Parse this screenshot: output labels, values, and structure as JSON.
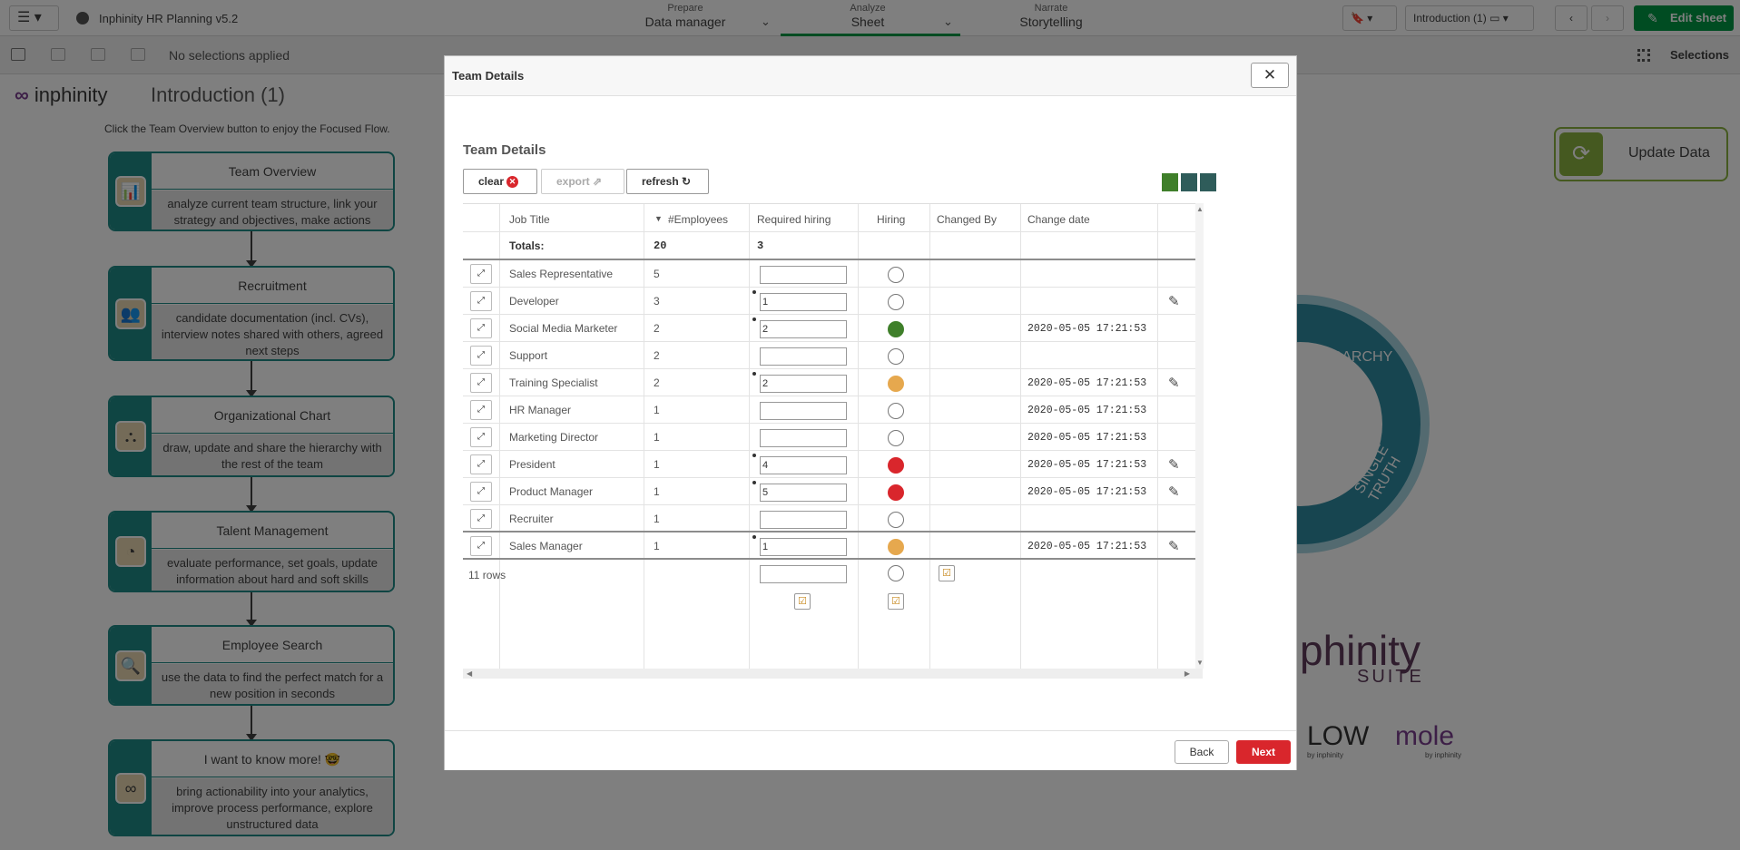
{
  "topbar": {
    "app_title": "Inphinity HR Planning v5.2",
    "prepare_label": "Prepare",
    "prepare_value": "Data manager",
    "analyze_label": "Analyze",
    "analyze_value": "Sheet",
    "narrate_label": "Narrate",
    "narrate_value": "Storytelling",
    "sheet_name": "Introduction (1)",
    "edit_label": "Edit sheet"
  },
  "selectionbar": {
    "no_selections": "No selections applied",
    "selections_label": "Selections"
  },
  "sheet": {
    "logo_text": "inphinity",
    "title": "Introduction (1)",
    "hint": "Click the Team Overview button to enjoy the Focused Flow.",
    "update_label": "Update Data",
    "cards": [
      {
        "title": "Team Overview",
        "desc": "analyze current team structure, link your strategy and objectives, make actions"
      },
      {
        "title": "Recruitment",
        "desc": "candidate documentation (incl. CVs), interview notes shared with others, agreed next steps"
      },
      {
        "title": "Organizational Chart",
        "desc": "draw, update and share the hierarchy with the rest of the team"
      },
      {
        "title": "Talent Management",
        "desc": "evaluate performance, set goals, update information about hard and soft skills"
      },
      {
        "title": "Employee Search",
        "desc": "use the data to find the perfect match for a new position in seconds"
      },
      {
        "title": "I want to know more! 🤓",
        "desc": "bring actionability into your analytics, improve process performance, explore unstructured data"
      }
    ],
    "ring_hierarchy": "HIERARCHY",
    "ring_truth": "SINGLE TRUTH",
    "suite_brand": "phinity",
    "suite_word": "SUITE",
    "flow_brand": "LOW",
    "mole_brand": "mole",
    "by_inphinity_1": "by inphinity",
    "by_inphinity_2": "by inphinity"
  },
  "modal": {
    "title": "Team Details",
    "section_title": "Team Details",
    "clear_label": "clear",
    "export_label": "export",
    "refresh_label": "refresh",
    "back_label": "Back",
    "next_label": "Next",
    "columns": [
      "Job Title",
      "#Employees",
      "Required hiring",
      "Hiring",
      "Changed By",
      "Change date"
    ],
    "totals_label": "Totals:",
    "total_employees": "20",
    "total_required": "3",
    "rows_count": "11 rows",
    "status_colors": {
      "green": "#3f7f2a",
      "orange": "#e6a84e",
      "red": "#d9262c",
      "empty": "#ffffff"
    },
    "rows": [
      {
        "job": "Sales Representative",
        "emp": "5",
        "req": "",
        "status": "empty",
        "date": "",
        "edit": false
      },
      {
        "job": "Developer",
        "emp": "3",
        "req": "1",
        "status": "empty",
        "date": "",
        "edit": true
      },
      {
        "job": "Social Media Marketer",
        "emp": "2",
        "req": "2",
        "status": "green",
        "date": "2020-05-05 17:21:53",
        "edit": false
      },
      {
        "job": "Support",
        "emp": "2",
        "req": "",
        "status": "empty",
        "date": "",
        "edit": false
      },
      {
        "job": "Training Specialist",
        "emp": "2",
        "req": "2",
        "status": "orange",
        "date": "2020-05-05 17:21:53",
        "edit": true
      },
      {
        "job": "HR Manager",
        "emp": "1",
        "req": "",
        "status": "empty",
        "date": "2020-05-05 17:21:53",
        "edit": false
      },
      {
        "job": "Marketing Director",
        "emp": "1",
        "req": "",
        "status": "empty",
        "date": "2020-05-05 17:21:53",
        "edit": false
      },
      {
        "job": "President",
        "emp": "1",
        "req": "4",
        "status": "red",
        "date": "2020-05-05 17:21:53",
        "edit": true
      },
      {
        "job": "Product Manager",
        "emp": "1",
        "req": "5",
        "status": "red",
        "date": "2020-05-05 17:21:53",
        "edit": true
      },
      {
        "job": "Recruiter",
        "emp": "1",
        "req": "",
        "status": "empty",
        "date": "",
        "edit": false
      },
      {
        "job": "Sales Manager",
        "emp": "1",
        "req": "1",
        "status": "orange",
        "date": "2020-05-05 17:21:53",
        "edit": true
      }
    ]
  }
}
